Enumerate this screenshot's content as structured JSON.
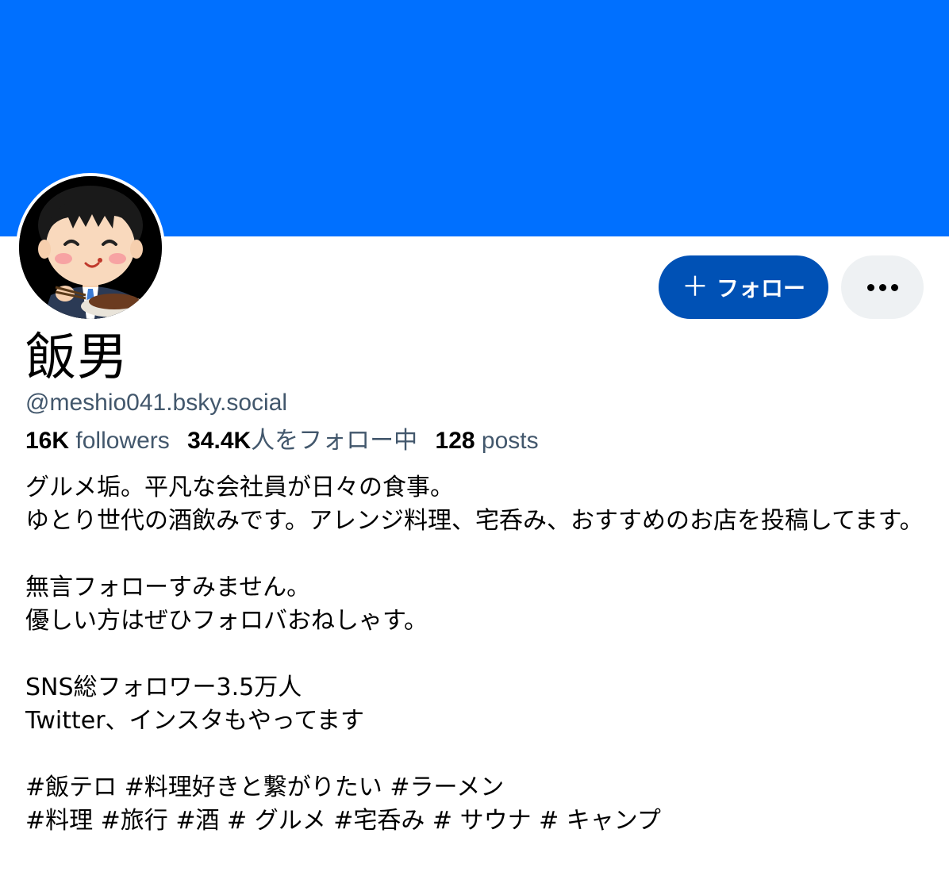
{
  "colors": {
    "banner": "#0070ff",
    "follow_button_bg": "#0051b5",
    "secondary_text": "#42576c",
    "more_button_bg": "#eef1f3"
  },
  "profile": {
    "display_name": "飯男",
    "handle": "@meshio041.bsky.social",
    "avatar": "cartoon-man-eating-icon"
  },
  "actions": {
    "follow_icon": "plus-icon",
    "follow_label": "フォロー",
    "more_icon": "ellipsis-icon"
  },
  "stats": {
    "followers_count": "16K",
    "followers_label": "followers",
    "following_count": "34.4K",
    "following_label": "人をフォロー中",
    "posts_count": "128",
    "posts_label": "posts"
  },
  "bio": {
    "line1": "グルメ垢。平凡な会社員が日々の食事。",
    "line2": "ゆとり世代の酒飲みです。アレンジ料理、宅呑み、おすすめのお店を投稿してます。",
    "line3": "無言フォローすみません。",
    "line4": "優しい方はぜひフォロバおねしゃす。",
    "line5": "SNS総フォロワー3.5万人",
    "line6": "Twitter、インスタもやってます",
    "line7": "#飯テロ #料理好きと繋がりたい #ラーメン",
    "line8": "#料理 #旅行 #酒 # グルメ #宅呑み # サウナ # キャンプ"
  }
}
